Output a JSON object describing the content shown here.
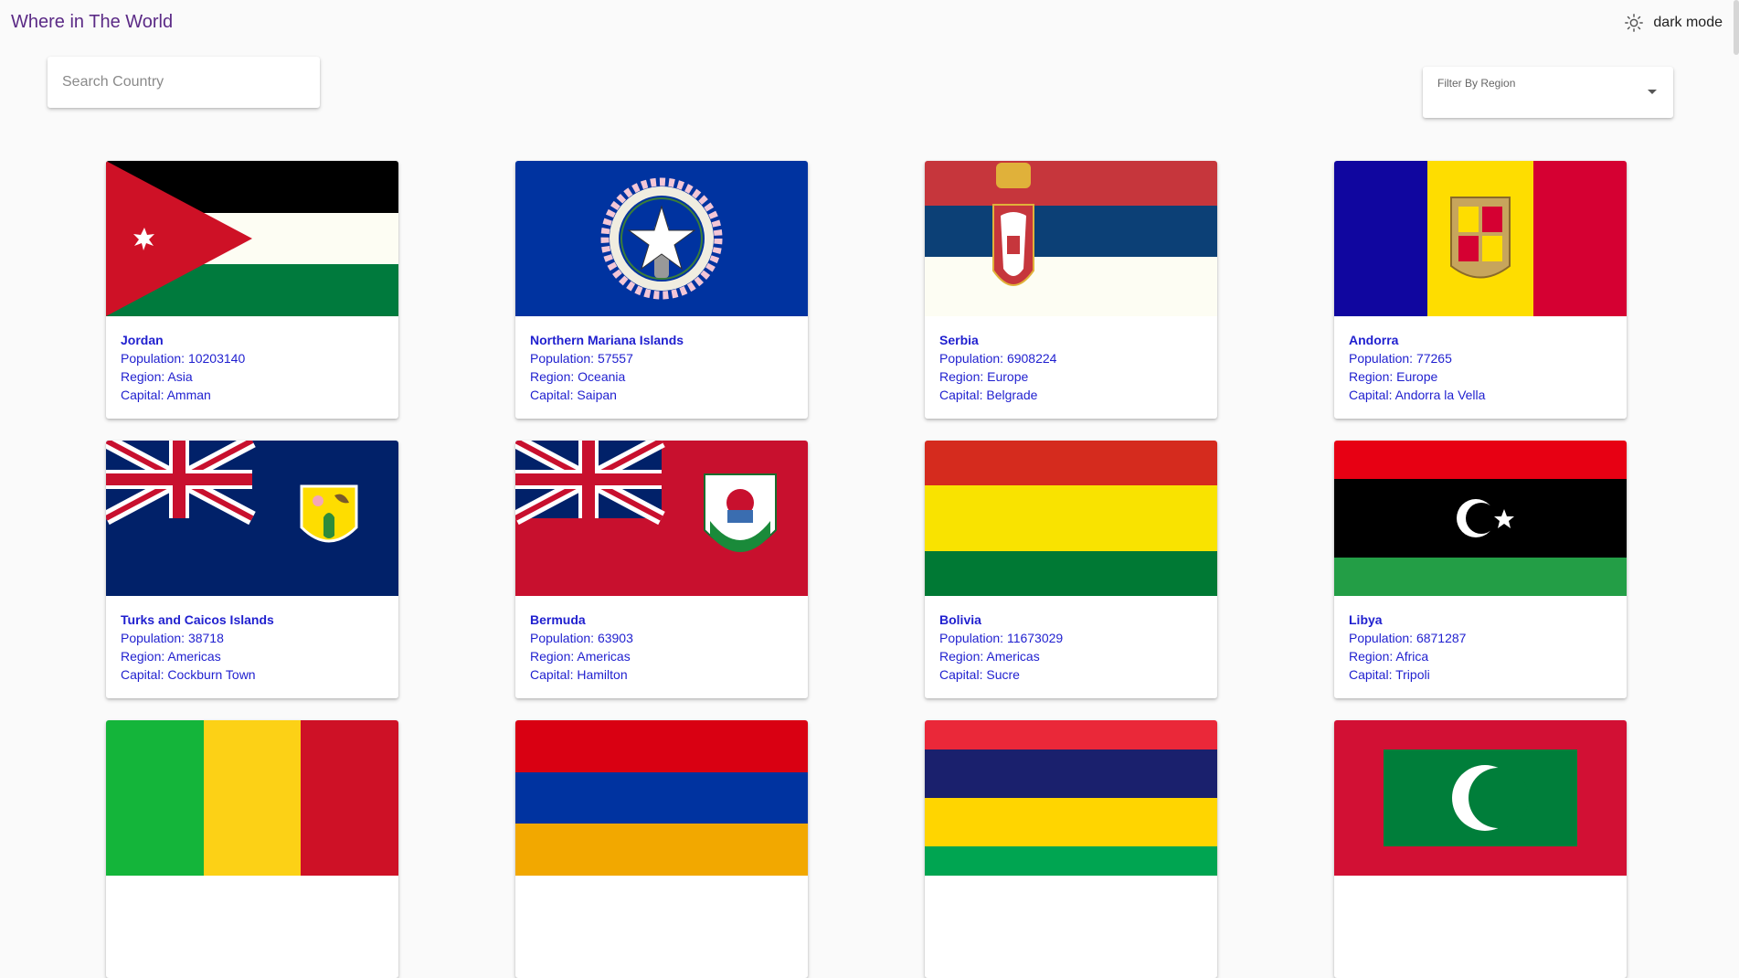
{
  "header": {
    "title": "Where in The World",
    "theme_label": "dark mode",
    "theme_icon": "brightness-icon"
  },
  "search": {
    "placeholder": "Search Country",
    "value": ""
  },
  "filter": {
    "label": "Filter By Region",
    "value": ""
  },
  "countries": [
    {
      "name": "Jordan",
      "population": "Population: 10203140",
      "region": "Region: Asia",
      "capital": "Capital: Amman"
    },
    {
      "name": "Northern Mariana Islands",
      "population": "Population: 57557",
      "region": "Region: Oceania",
      "capital": "Capital: Saipan"
    },
    {
      "name": "Serbia",
      "population": "Population: 6908224",
      "region": "Region: Europe",
      "capital": "Capital: Belgrade"
    },
    {
      "name": "Andorra",
      "population": "Population: 77265",
      "region": "Region: Europe",
      "capital": "Capital: Andorra la Vella"
    },
    {
      "name": "Turks and Caicos Islands",
      "population": "Population: 38718",
      "region": "Region: Americas",
      "capital": "Capital: Cockburn Town"
    },
    {
      "name": "Bermuda",
      "population": "Population: 63903",
      "region": "Region: Americas",
      "capital": "Capital: Hamilton"
    },
    {
      "name": "Bolivia",
      "population": "Population: 11673029",
      "region": "Region: Americas",
      "capital": "Capital: Sucre"
    },
    {
      "name": "Libya",
      "population": "Population: 6871287",
      "region": "Region: Africa",
      "capital": "Capital: Tripoli"
    }
  ],
  "partial_flags": [
    "mali-flag",
    "armenia-flag",
    "mauritius-flag",
    "maldives-flag"
  ]
}
